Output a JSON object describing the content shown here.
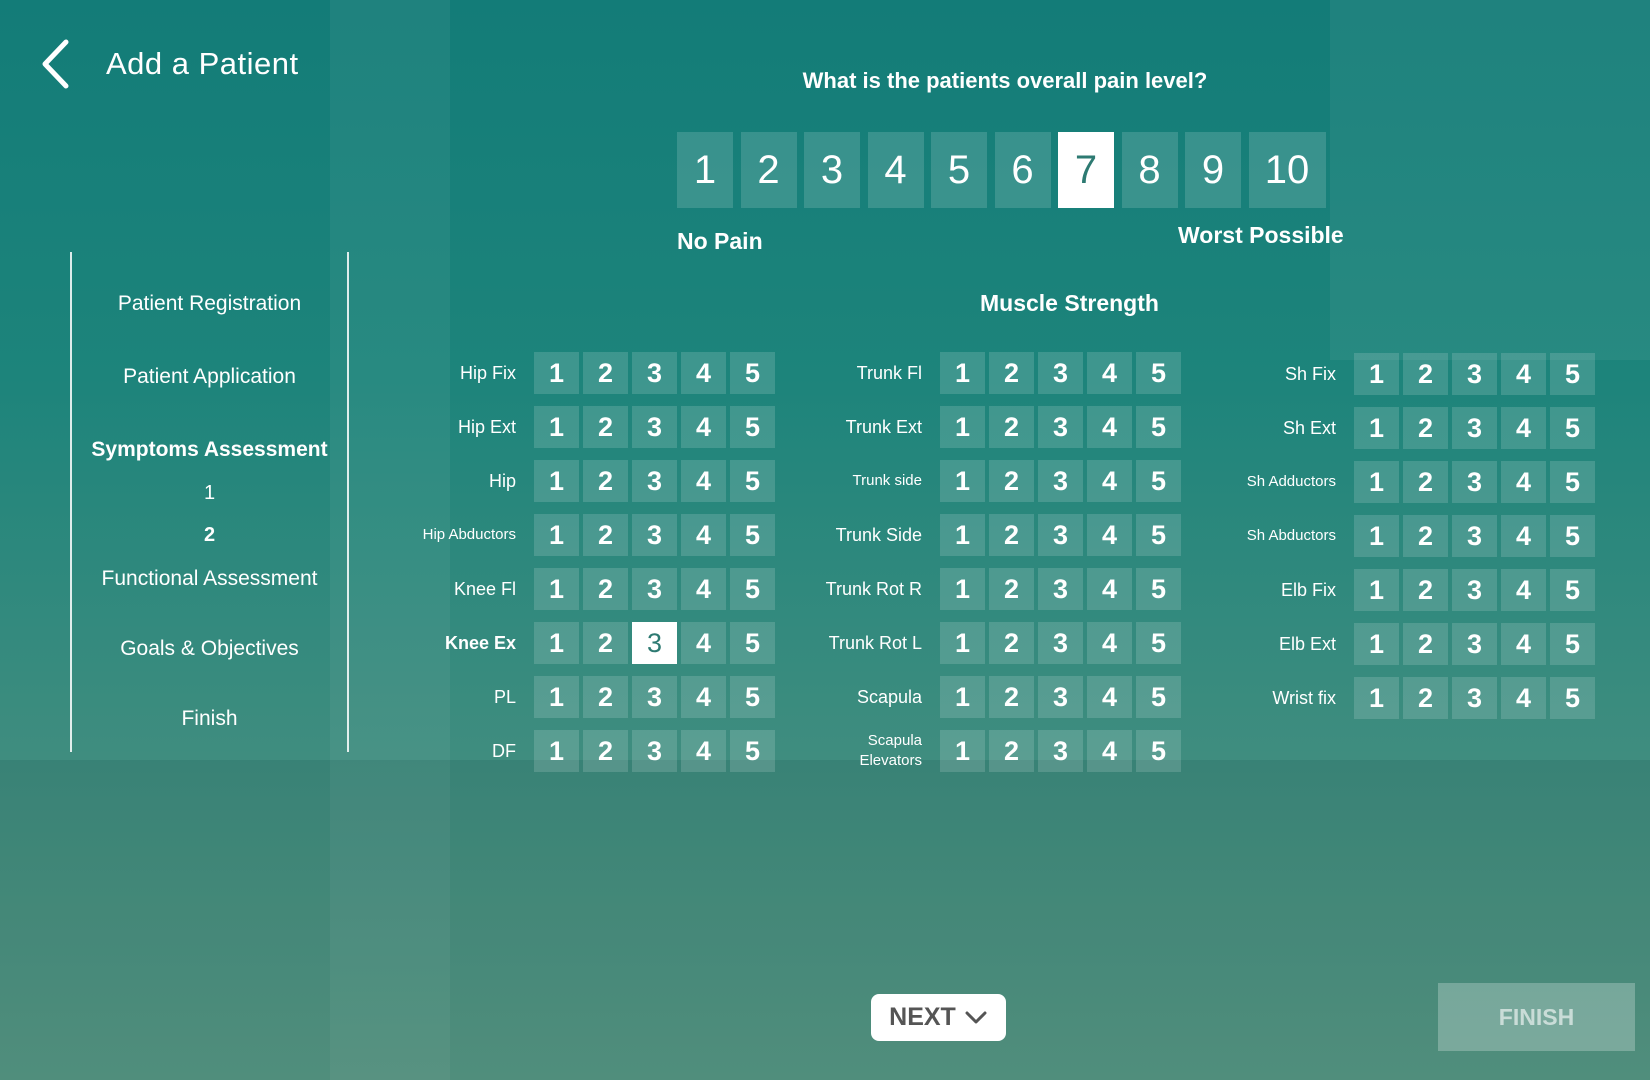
{
  "header": {
    "title": "Add a Patient"
  },
  "sidebar": {
    "items": [
      {
        "label": "Patient Registration"
      },
      {
        "label": "Patient Application"
      },
      {
        "label": "Symptoms Assessment"
      },
      {
        "label": "1"
      },
      {
        "label": "2"
      },
      {
        "label": "Functional Assessment"
      },
      {
        "label": "Goals & Objectives"
      },
      {
        "label": "Finish"
      }
    ]
  },
  "pain": {
    "question": "What is the patients overall pain level?",
    "options": [
      "1",
      "2",
      "3",
      "4",
      "5",
      "6",
      "7",
      "8",
      "9",
      "10"
    ],
    "selected": "7",
    "min_label": "No Pain",
    "max_label": "Worst Possible"
  },
  "muscle_strength": {
    "title": "Muscle Strength",
    "scale": [
      "1",
      "2",
      "3",
      "4",
      "5"
    ],
    "col1": [
      {
        "label": "Hip Fix"
      },
      {
        "label": "Hip Ext"
      },
      {
        "label": "Hip"
      },
      {
        "label": "Hip Abductors"
      },
      {
        "label": "Knee Fl"
      },
      {
        "label": "Knee Ex",
        "selected": "3"
      },
      {
        "label": "PL"
      },
      {
        "label": "DF"
      }
    ],
    "col2": [
      {
        "label": "Trunk Fl"
      },
      {
        "label": "Trunk Ext"
      },
      {
        "label": "Trunk side"
      },
      {
        "label": "Trunk Side"
      },
      {
        "label": "Trunk Rot R"
      },
      {
        "label": "Trunk Rot L"
      },
      {
        "label": "Scapula"
      },
      {
        "label": "Scapula Elevators"
      }
    ],
    "col3": [
      {
        "label": "Sh Fix"
      },
      {
        "label": "Sh Ext"
      },
      {
        "label": "Sh Adductors"
      },
      {
        "label": "Sh Abductors"
      },
      {
        "label": "Elb Fix"
      },
      {
        "label": "Elb Ext"
      },
      {
        "label": "Wrist fix"
      }
    ]
  },
  "footer": {
    "next_label": "NEXT",
    "finish_label": "FINISH"
  }
}
